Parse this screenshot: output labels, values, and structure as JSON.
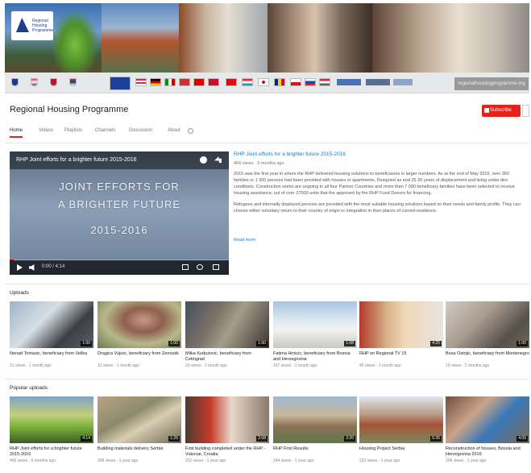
{
  "logo": {
    "text": "Regional Housing Programme"
  },
  "search_placeholder": "regionalhousingprogramme.org",
  "channel": {
    "title": "Regional Housing Programme",
    "subscribe_label": "Subscribe"
  },
  "tabs": [
    {
      "label": "Home"
    },
    {
      "label": "Videos"
    },
    {
      "label": "Playlists"
    },
    {
      "label": "Channels"
    },
    {
      "label": "Discussion"
    },
    {
      "label": "About"
    }
  ],
  "featured": {
    "player_title": "RHP Joint efforts for a brighter future 2015-2016",
    "overlay_line1": "JOINT EFFORTS FOR",
    "overlay_line2": "A BRIGHTER FUTURE",
    "overlay_line3": "2015-2016",
    "time": "0:00 / 4:14",
    "progress": 0.02,
    "title": "RHP Joint efforts for a brighter future 2015-2016",
    "meta": "466 views · 6 months ago",
    "description_1": "2015 was the first year in where the RHP delivered housing solutions to beneficiaries in larger numbers. As at the end of May 2016, over 350 families or 1 300 persons had been provided with houses or apartments. Designed as end 25 20 years of displacement and living under dire conditions. Construction works are ongoing in all four Partner Countries and more than 7 000 beneficiary families have been selected to receive housing assistance; out of over 27000 units that the approved by the RHP Fund Donors for financing.",
    "description_2": "Refugees and internally displaced persons are provided with the most suitable housing solutions based on their needs and family profile. They can choose either voluntary return to their country of origin or integration in their places of current residence.",
    "read_more": "Read more"
  },
  "uploads": {
    "title": "Uploads",
    "items": [
      {
        "title": "Nenad Tomasic, beneficiary from Velika",
        "meta": "21 views · 1 month ago",
        "duration": "1:00"
      },
      {
        "title": "Dragica Vujicic, beneficiary from Zemunik",
        "meta": "13 views · 1 month ago",
        "duration": "1:00"
      },
      {
        "title": "Milka Kuduzovic, beneficiary from Cetingrad",
        "meta": "23 views · 1 month ago",
        "duration": "1:00"
      },
      {
        "title": "Fatima Hrnicic, beneficiary from Bosnia and Herzegovina",
        "meta": "167 views · 1 month ago",
        "duration": "1:08"
      },
      {
        "title": "RHP on Regional TV 15",
        "meta": "45 views · 1 month ago",
        "duration": "4:25"
      },
      {
        "title": "Bosa Ostojic, beneficiary from Montenegro",
        "meta": "19 views · 2 months ago",
        "duration": "1:00"
      }
    ]
  },
  "popular": {
    "title": "Popular uploads",
    "items": [
      {
        "title": "RHP Joint efforts for a brighter future 2015-2016",
        "meta": "466 views · 6 months ago",
        "duration": "4:14"
      },
      {
        "title": "Building materials delivery Serbia",
        "meta": "368 views · 1 year ago",
        "duration": "1:26"
      },
      {
        "title": "First building completed under the RHP - Vukovar, Croatia",
        "meta": "252 views · 1 year ago",
        "duration": "2:08"
      },
      {
        "title": "RHP First Results",
        "meta": "244 views · 1 year ago",
        "duration": "3:20"
      },
      {
        "title": "Housing Project Serbia",
        "meta": "222 views · 1 year ago",
        "duration": "5:35"
      },
      {
        "title": "Reconstruction of houses, Bosnia and Herzegovina 2016",
        "meta": "208 views · 1 year ago",
        "duration": "4:05"
      }
    ]
  }
}
